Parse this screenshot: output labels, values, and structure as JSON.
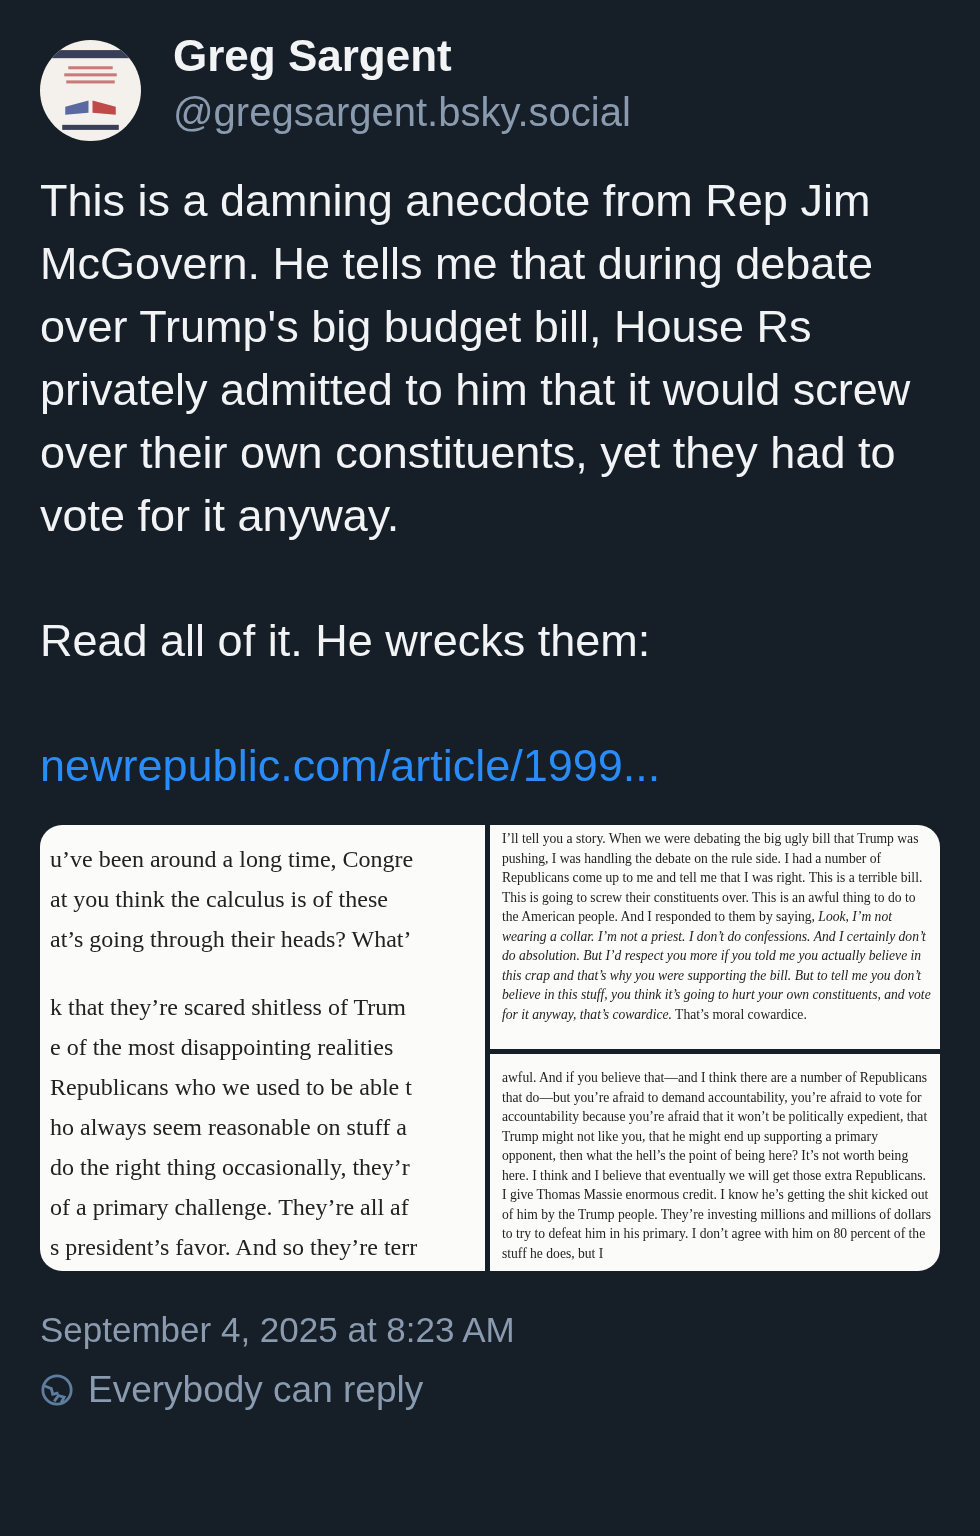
{
  "post": {
    "avatar": {
      "kind": "picture"
    },
    "author": {
      "name": "Greg Sargent",
      "handle": "@gregsargent.bsky.social"
    },
    "paragraphs": [
      "This is a damning anecdote from Rep Jim McGovern. He tells me that during debate over Trump's big budget bill, House Rs privately admitted to him that it would screw over their own constituents, yet they had to vote for it anyway.",
      "Read all of it. He wrecks them:"
    ],
    "link": "newrepublic.com/article/1999...",
    "images": [
      {
        "kind": "lines",
        "blocks": [
          [
            "u’ve been around a long time, Congre",
            "at you think the calculus is of these",
            "at’s going through their heads? What’"
          ],
          [
            "k that they’re scared shitless of Trum",
            "e of the most disappointing realities",
            "Republicans who we used to be able t",
            "ho always seem reasonable on stuff a",
            "do the right thing occasionally, they’r",
            "of a primary challenge. They’re all af",
            "s president’s favor. And so they’re terr"
          ]
        ]
      },
      {
        "kind": "paragraph",
        "text": "I’ll tell you a story. When we were debating the big ugly bill that Trump was pushing, I was handling the debate on the rule side. I had a number of Republicans come up to me and tell me that I was right. This is a terrible bill. This is going to screw their constituents over. This is an awful thing to do to the American people. And I responded to them by saying, *Look, I’m not wearing a collar. I’m not a priest. I don’t do confessions. And I certainly don’t do absolution. But I’d respect you more if you told me you actually believe in this crap and that’s why you were supporting the bill. But to tell me you don’t believe in this stuff, you think it’s going to hurt your own constituents, and vote for it anyway, that’s cowardice.* That’s moral cowardice."
      },
      {
        "kind": "paragraph",
        "text": "awful. And if you believe that—and I think there are a number of Republicans that do—but you’re afraid to demand accountability, you’re afraid to vote for accountability because you’re afraid that it won’t be politically expedient, that Trump might not like you, that he might end up supporting a primary opponent, then what the hell’s the point of being here? It’s not worth being here. I think and I believe that eventually we will get those extra Republicans. I give Thomas Massie enormous credit. I know he’s getting the shit kicked out of him by the Trump people. They’re investing millions and millions of dollars to try to defeat him in his primary. I don’t agree with him on 80 percent of the stuff he does, but I"
      }
    ],
    "timestamp": "September 4, 2025 at 8:23 AM",
    "reply_setting": "Everybody can reply"
  }
}
